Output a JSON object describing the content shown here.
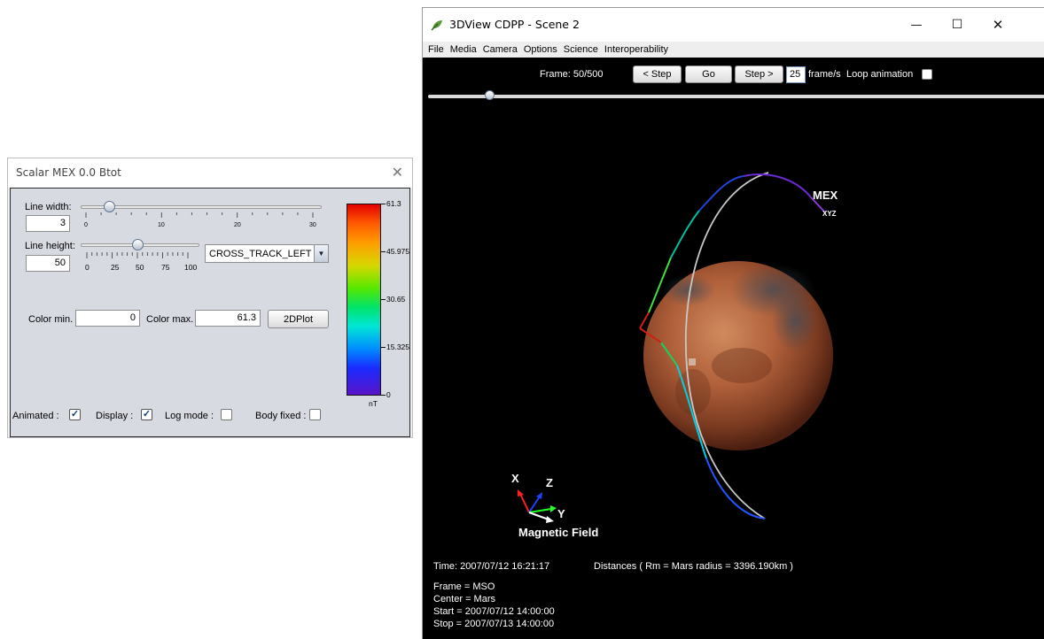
{
  "main_window": {
    "title": "3DView CDPP - Scene 2",
    "icon": "leaf-icon",
    "controls": {
      "minimize": "—",
      "maximize": "☐",
      "close": "✕"
    },
    "menu": [
      "File",
      "Media",
      "Camera",
      "Options",
      "Science",
      "Interoperability"
    ],
    "toolbar": {
      "frame_label": "Frame: 50/500",
      "step_back": "< Step",
      "go": "Go",
      "step_forward": "Step >",
      "fps_value": "25",
      "fps_label": "frame/s",
      "loop_label": "Loop animation",
      "loop_checked": false,
      "frame_current": 50,
      "frame_total": 500
    },
    "scene": {
      "spacecraft_label": "MEX",
      "spacecraft_axes": "XYZ",
      "axes_labels": {
        "x": "X",
        "y": "Y",
        "z": "Z"
      },
      "field_label": "Magnetic Field"
    },
    "info": {
      "time": "Time: 2007/07/12 16:21:17",
      "distances": "Distances ( Rm = Mars radius = 3396.190km )",
      "frame": "Frame = MSO",
      "center": "Center = Mars",
      "start": "Start = 2007/07/12 14:00:00",
      "stop": "Stop = 2007/07/13 14:00:00"
    }
  },
  "scalar_dialog": {
    "title": "Scalar MEX 0.0 Btot",
    "close": "✕",
    "line_width": {
      "label": "Line width:",
      "value": "3",
      "slider_value": 3,
      "min": 0,
      "max": 30,
      "ticks": [
        "0",
        "10",
        "20",
        "30"
      ]
    },
    "line_height": {
      "label": "Line height:",
      "value": "50",
      "slider_value": 50,
      "min": 0,
      "max": 100,
      "ticks": [
        "0",
        "25",
        "50",
        "75",
        "100"
      ]
    },
    "position_mode": "CROSS_TRACK_LEFT",
    "color_min": {
      "label": "Color min.",
      "value": "0"
    },
    "color_max": {
      "label": "Color max.",
      "value": "61.3"
    },
    "plot_button": "2DPlot",
    "animated": {
      "label": "Animated :",
      "checked": true
    },
    "display": {
      "label": "Display :",
      "checked": true
    },
    "log_mode": {
      "label": "Log mode :",
      "checked": false
    },
    "body_fixed": {
      "label": "Body fixed :",
      "checked": false
    },
    "colorbar": {
      "labels": [
        "61.3",
        "45.975",
        "30.65",
        "15.325",
        "0"
      ],
      "unit": "nT"
    }
  },
  "colors": {
    "background": "#000000",
    "dialog_bg": "#d8dae2",
    "menu_bg": "#eeeeee"
  }
}
